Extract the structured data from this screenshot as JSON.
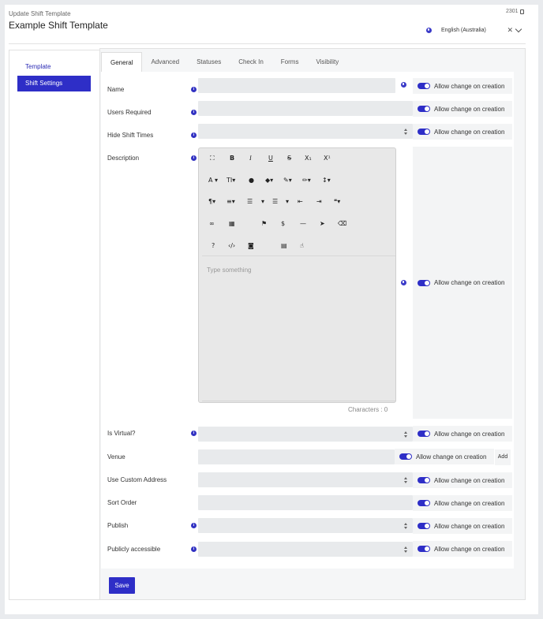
{
  "header": {
    "breadcrumb": "Update Shift Template",
    "title": "Example Shift Template",
    "record_id": "2301",
    "locale": "English (Australia)"
  },
  "sidebar": {
    "items": [
      {
        "label": "Template",
        "active": false
      },
      {
        "label": "Shift Settings",
        "active": true
      }
    ]
  },
  "tabs": [
    {
      "label": "General",
      "active": true
    },
    {
      "label": "Advanced",
      "active": false
    },
    {
      "label": "Statuses",
      "active": false
    },
    {
      "label": "Check In",
      "active": false
    },
    {
      "label": "Forms",
      "active": false
    },
    {
      "label": "Visibility",
      "active": false
    }
  ],
  "form": {
    "allow_change_label": "Allow change on creation",
    "fields": {
      "name": {
        "label": "Name",
        "value": ""
      },
      "users_required": {
        "label": "Users Required",
        "value": ""
      },
      "hide_shift_times": {
        "label": "Hide Shift Times",
        "value": ""
      },
      "description": {
        "label": "Description",
        "placeholder": "Type something",
        "char_count": "Characters : 0"
      },
      "is_virtual": {
        "label": "Is Virtual?",
        "value": ""
      },
      "venue": {
        "label": "Venue",
        "value": "",
        "add_label": "Add"
      },
      "use_custom_address": {
        "label": "Use Custom Address",
        "value": ""
      },
      "sort_order": {
        "label": "Sort Order",
        "value": ""
      },
      "publish": {
        "label": "Publish",
        "value": ""
      },
      "publicly_accessible": {
        "label": "Publicly accessible",
        "value": ""
      }
    }
  },
  "editor_toolbar": {
    "bold": "B",
    "italic": "I",
    "underline": "U",
    "strikethrough": "S",
    "subscript": "X₁",
    "superscript": "X¹",
    "font_family": "A",
    "font_size": "TI",
    "help": "?",
    "insert_math": "$"
  },
  "footer": {
    "save_label": "Save"
  },
  "colors": {
    "accent": "#2e2ec7",
    "field_bg": "#e8eaec"
  }
}
